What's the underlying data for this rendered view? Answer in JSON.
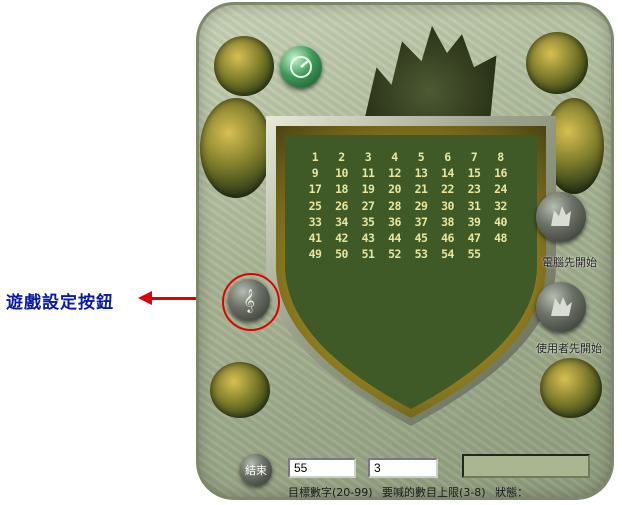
{
  "annotation": {
    "label": "遊戲設定按鈕",
    "arrow_color": "#e00000",
    "label_color": "#0a1aa8"
  },
  "board": {
    "numbers": [
      "1",
      "2",
      "3",
      "4",
      "5",
      "6",
      "7",
      "8",
      "9",
      "10",
      "11",
      "12",
      "13",
      "14",
      "15",
      "16",
      "17",
      "18",
      "19",
      "20",
      "21",
      "22",
      "23",
      "24",
      "25",
      "26",
      "27",
      "28",
      "29",
      "30",
      "31",
      "32",
      "33",
      "34",
      "35",
      "36",
      "37",
      "38",
      "39",
      "40",
      "41",
      "42",
      "43",
      "44",
      "45",
      "46",
      "47",
      "48",
      "49",
      "50",
      "51",
      "52",
      "53",
      "54",
      "55"
    ],
    "number_color": "#e9e6a0",
    "shield_color": "#3f5a26"
  },
  "buttons": {
    "computer_first": "電腦先開始",
    "user_first": "使用者先開始",
    "end": "結束",
    "settings_icon": "treble-clef-icon",
    "top_icon": "clock-needle-icon"
  },
  "inputs": {
    "target_value": "55",
    "max_call_value": "3"
  },
  "labels": {
    "target": "目標數字(20-99)",
    "max_call": "要喊的數目上限(3-8)",
    "status": "狀態："
  }
}
